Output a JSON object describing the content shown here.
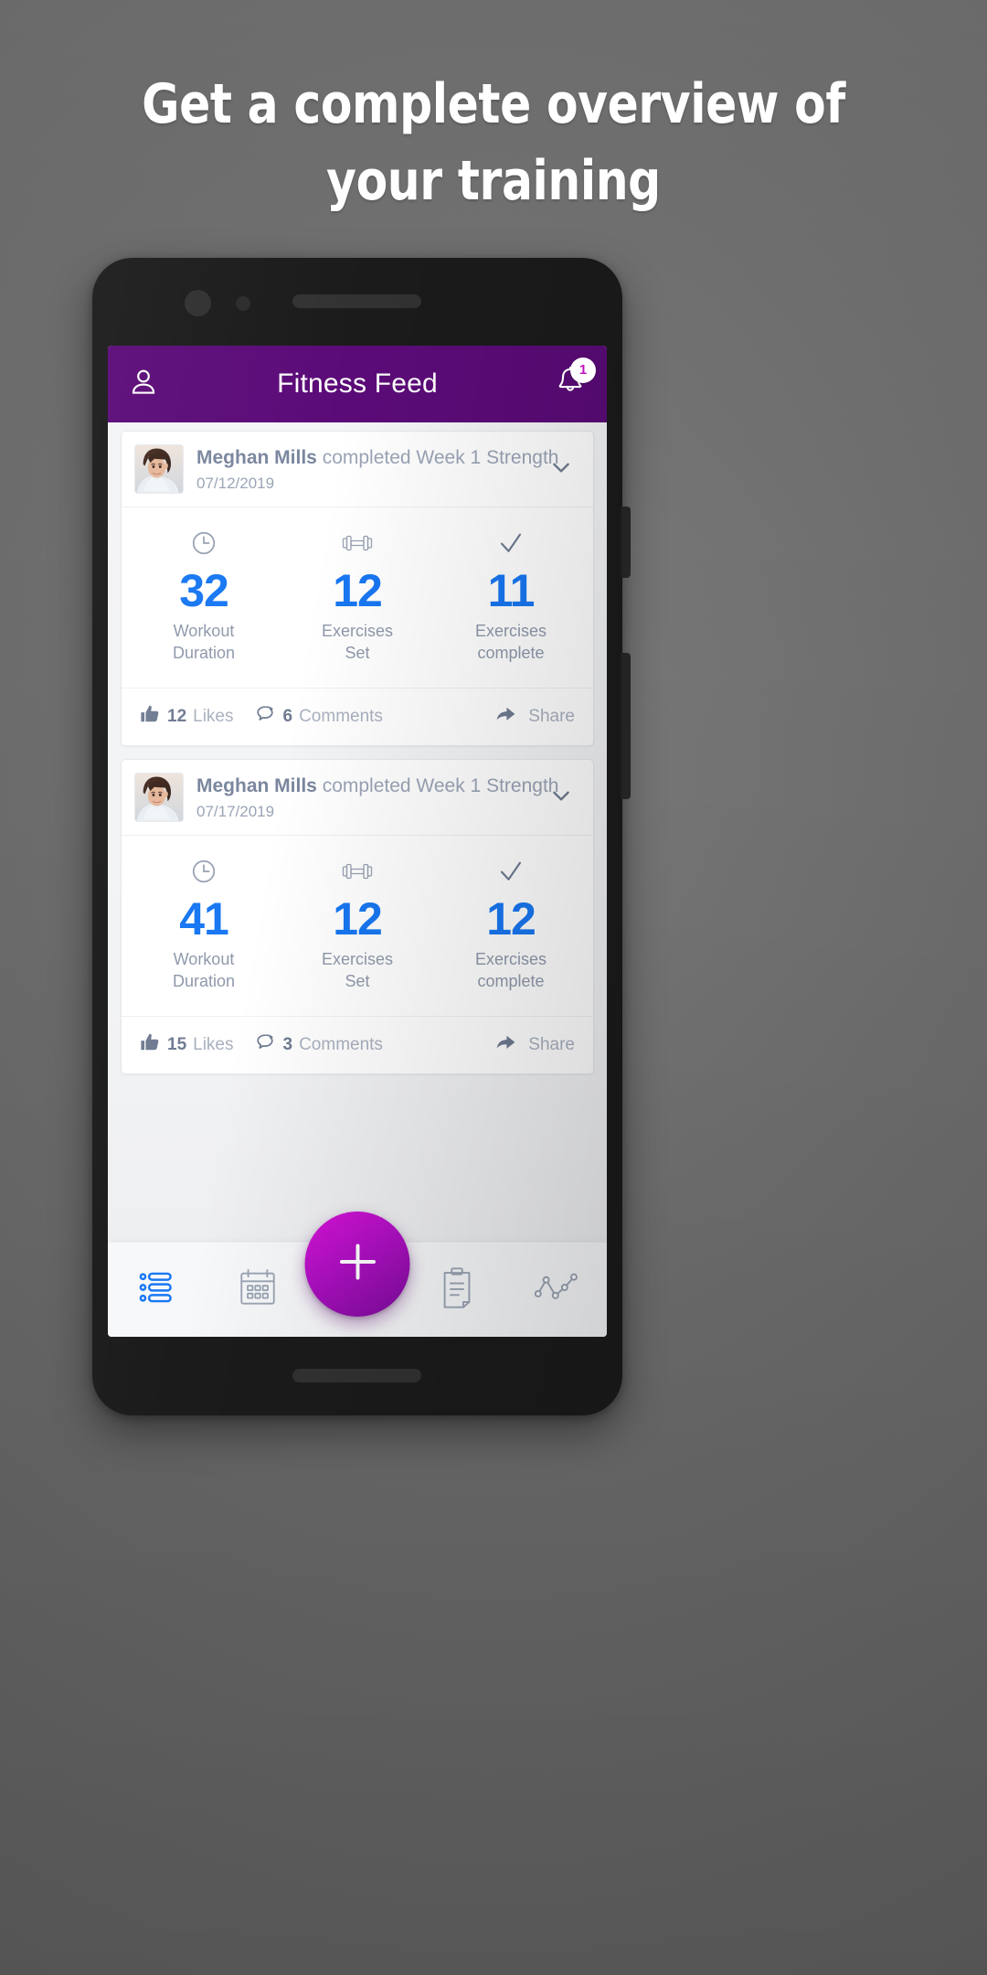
{
  "headline": {
    "line1": "Get a complete overview of",
    "line2": "your training"
  },
  "colors": {
    "appbar_purple": "#5B0B78",
    "stat_blue": "#1877F2",
    "fab_magenta": "#D812D8",
    "fab_purple": "#7D0C9C",
    "badge_text": "#C215C2",
    "background_gray": "#6E6E6E"
  },
  "appbar": {
    "title": "Fitness Feed",
    "profile_icon": "person-icon",
    "notifications_icon": "bell-icon",
    "badge_count": "1"
  },
  "posts": [
    {
      "user": "Meghan Mills",
      "action": "completed Week 1 Strength",
      "date": "07/12/2019",
      "avatar_icon": "avatar-photo",
      "expand_icon": "chevron-down-icon",
      "stats": [
        {
          "icon": "clock-icon",
          "value": "32",
          "label_line1": "Workout",
          "label_line2": "Duration"
        },
        {
          "icon": "dumbbell-icon",
          "value": "12",
          "label_line1": "Exercises",
          "label_line2": "Set"
        },
        {
          "icon": "check-icon",
          "value": "11",
          "label_line1": "Exercises",
          "label_line2": "complete"
        }
      ],
      "social": {
        "likes_icon": "thumbs-up-icon",
        "likes_count": "12",
        "likes_label": "Likes",
        "comments_icon": "comment-icon",
        "comments_count": "6",
        "comments_label": "Comments",
        "share_icon": "share-arrow-icon",
        "share_label": "Share"
      }
    },
    {
      "user": "Meghan Mills",
      "action": "completed Week 1 Strength",
      "date": "07/17/2019",
      "avatar_icon": "avatar-photo",
      "expand_icon": "chevron-down-icon",
      "stats": [
        {
          "icon": "clock-icon",
          "value": "41",
          "label_line1": "Workout",
          "label_line2": "Duration"
        },
        {
          "icon": "dumbbell-icon",
          "value": "12",
          "label_line1": "Exercises",
          "label_line2": "Set"
        },
        {
          "icon": "check-icon",
          "value": "12",
          "label_line1": "Exercises",
          "label_line2": "complete"
        }
      ],
      "social": {
        "likes_icon": "thumbs-up-icon",
        "likes_count": "15",
        "likes_label": "Likes",
        "comments_icon": "comment-icon",
        "comments_count": "3",
        "comments_label": "Comments",
        "share_icon": "share-arrow-icon",
        "share_label": "Share"
      }
    }
  ],
  "bottom_nav": {
    "items": [
      {
        "icon": "list-icon",
        "active": true
      },
      {
        "icon": "calendar-icon",
        "active": false
      },
      {
        "icon": "clipboard-icon",
        "active": false
      },
      {
        "icon": "chart-line-icon",
        "active": false
      }
    ],
    "fab_icon": "plus-icon"
  }
}
